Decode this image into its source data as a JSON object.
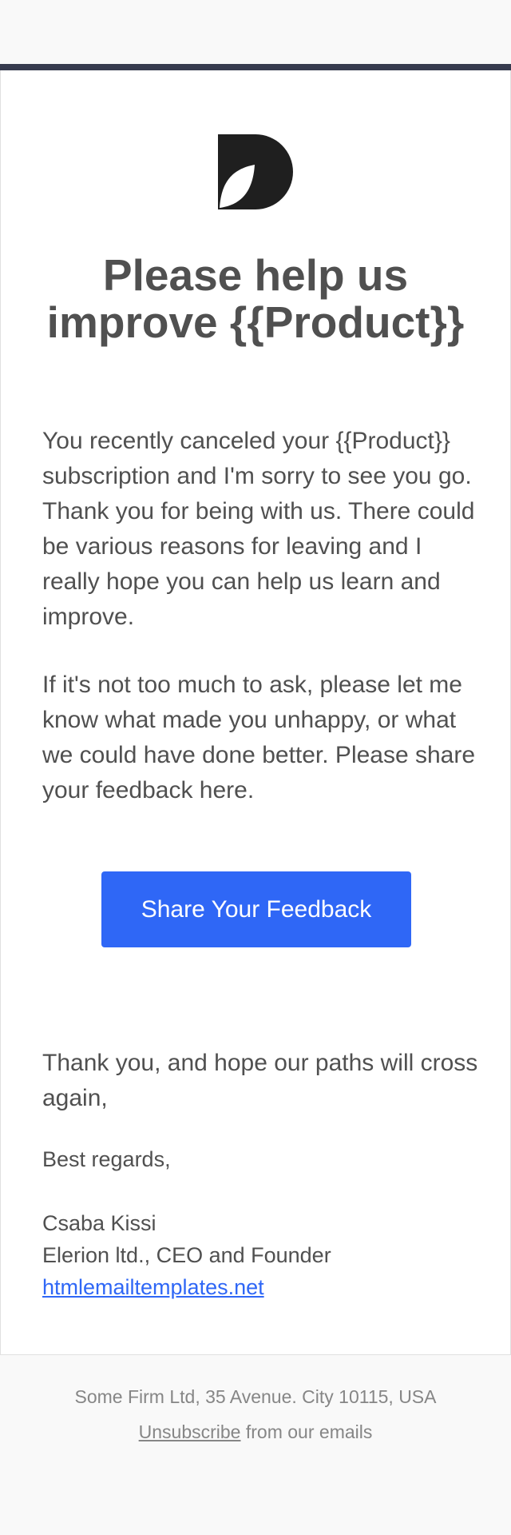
{
  "email": {
    "title": "Please help us improve {{Product}}",
    "paragraph1": "You recently canceled your {{Product}} subscription and I'm sorry to see you go. Thank you for being with us. There could be various reasons for leaving and I really hope you can help us learn and improve.",
    "paragraph2": "If it's not too much to ask, please let me know what made you unhappy, or what we could have done better. Please share your feedback here.",
    "cta_label": "Share Your Feedback",
    "closing": "Thank you, and hope our paths will cross again,",
    "regards": "Best regards,",
    "signature": {
      "name": "Csaba Kissi",
      "role": "Elerion ltd., CEO and Founder",
      "link": "htmlemailtemplates.net"
    }
  },
  "footer": {
    "address": "Some Firm Ltd, 35 Avenue. City 10115, USA",
    "unsubscribe_link": "Unsubscribe",
    "unsubscribe_suffix": " from our emails"
  },
  "colors": {
    "accent": "#2f67f6",
    "topbar": "#373b4f",
    "text": "#505050",
    "footer_text": "#868686",
    "background": "#f9f9f9"
  },
  "icons": {
    "logo": "leaf-d-logo-icon"
  }
}
